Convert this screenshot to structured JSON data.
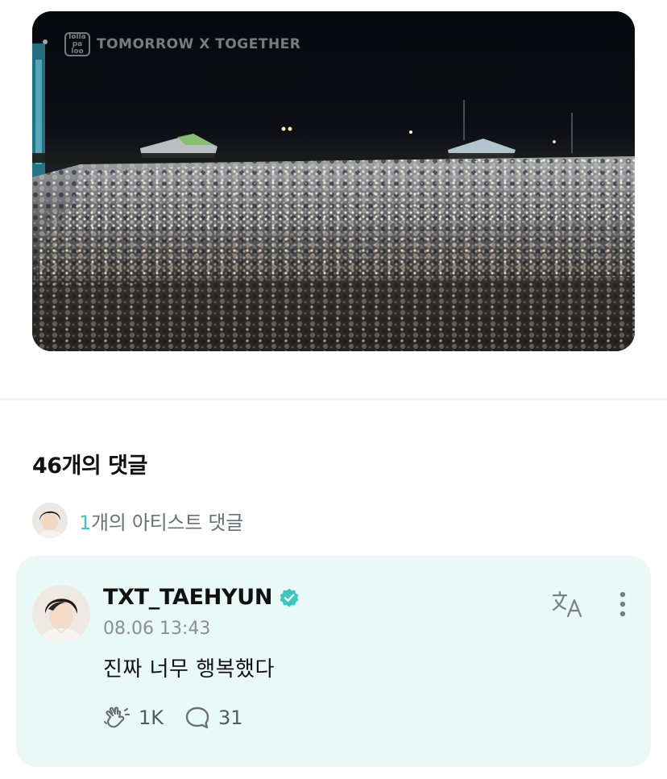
{
  "media": {
    "brand_logo_text": "lolla palooza",
    "watermark": "TOMORROW X TOGETHER"
  },
  "comments": {
    "title": "46개의 댓글",
    "artist_link": {
      "count_text": "1",
      "label_text": "개의 아티스트 댓글"
    }
  },
  "artist_comment": {
    "author": "TXT_TAEHYUN",
    "timestamp": "08.06 13:43",
    "body": "진짜 너무 행복했다",
    "like_count": "1K",
    "reply_count": "31",
    "icons": {
      "verified": "verified-badge-icon",
      "translate": "translate-icon",
      "more": "more-vertical-icon",
      "like": "cheer-hand-icon",
      "reply": "speech-bubble-icon"
    }
  },
  "colors": {
    "accent_teal": "#3ec6c0",
    "card_background": "#e9f9f7",
    "muted_text": "#8a8f96"
  }
}
